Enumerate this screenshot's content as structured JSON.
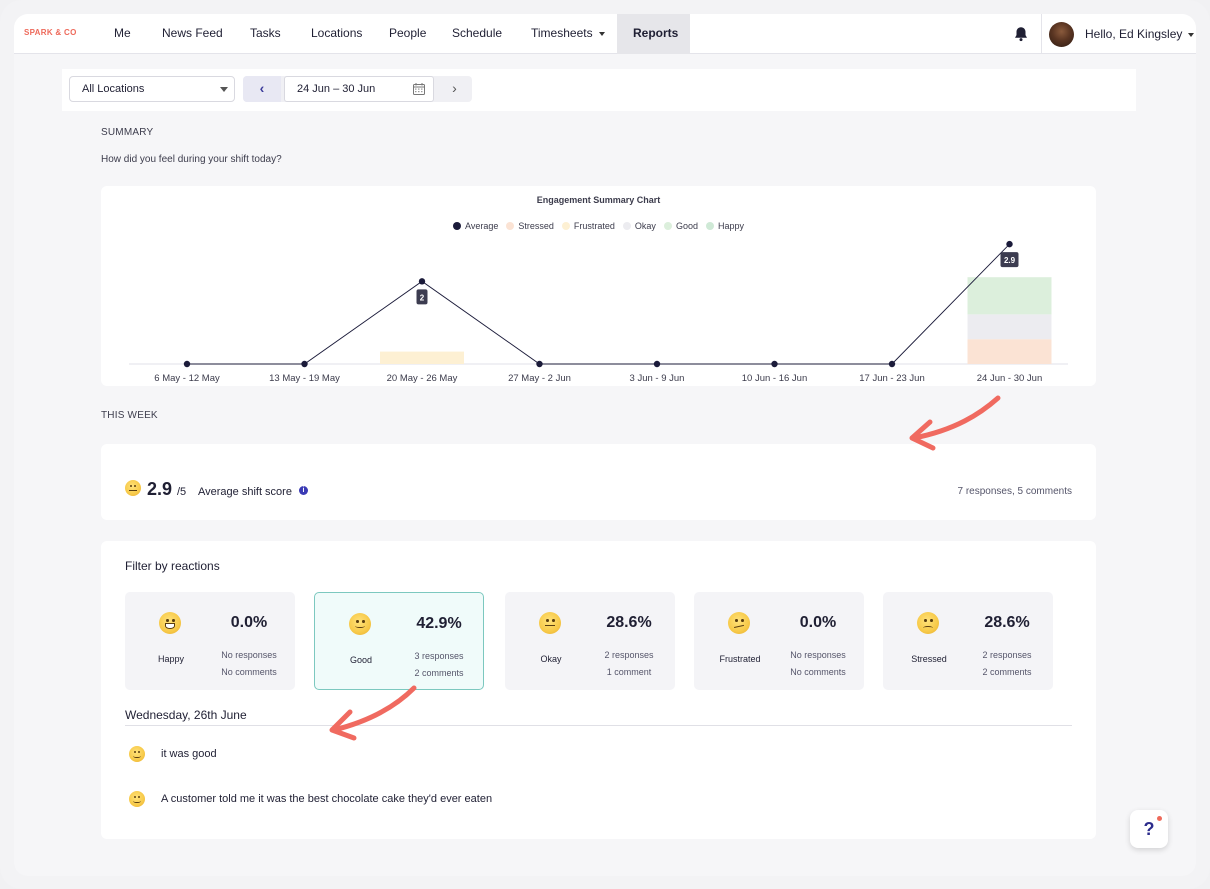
{
  "brand": "SPARK & CO",
  "nav": {
    "items": [
      {
        "label": "Me"
      },
      {
        "label": "News Feed"
      },
      {
        "label": "Tasks"
      },
      {
        "label": "Locations"
      },
      {
        "label": "People"
      },
      {
        "label": "Schedule"
      },
      {
        "label": "Timesheets"
      },
      {
        "label": "Reports"
      }
    ],
    "active": "Reports",
    "greeting": "Hello, Ed Kingsley"
  },
  "toolbar": {
    "location_select": "All Locations",
    "date_range": "24 Jun – 30 Jun"
  },
  "summary": {
    "heading": "SUMMARY",
    "question": "How did you feel during your shift today?"
  },
  "chart_data": {
    "type": "line",
    "title": "Engagement Summary Chart",
    "legend": [
      {
        "name": "Average",
        "color": "#1b1b3a"
      },
      {
        "name": "Stressed",
        "color": "#fbe3d4"
      },
      {
        "name": "Frustrated",
        "color": "#fdf0d3"
      },
      {
        "name": "Okay",
        "color": "#ececf0"
      },
      {
        "name": "Good",
        "color": "#dcefdc"
      },
      {
        "name": "Happy",
        "color": "#cfe9d6"
      }
    ],
    "categories": [
      "6 May - 12 May",
      "13 May - 19 May",
      "20 May - 26 May",
      "27 May - 2 Jun",
      "3 Jun - 9 Jun",
      "10 Jun - 16 Jun",
      "17 Jun - 23 Jun",
      "24 Jun - 30 Jun"
    ],
    "series": [
      {
        "name": "Average",
        "values": [
          0,
          0,
          2,
          0,
          0,
          0,
          0,
          2.9
        ]
      }
    ],
    "data_labels": [
      {
        "index": 2,
        "text": "2"
      },
      {
        "index": 7,
        "text": "2.9"
      }
    ],
    "stacks": [
      {
        "index": 2,
        "segments": [
          {
            "name": "Frustrated",
            "value": 0.3
          }
        ]
      },
      {
        "index": 7,
        "segments": [
          {
            "name": "Stressed",
            "value": 0.6
          },
          {
            "name": "Okay",
            "value": 0.6
          },
          {
            "name": "Good",
            "value": 0.9
          }
        ]
      }
    ],
    "ylim": [
      0,
      3
    ]
  },
  "this_week": {
    "heading": "THIS WEEK",
    "score": "2.9",
    "score_suffix": "/5",
    "score_label": "Average shift score",
    "responses_summary": "7 responses, 5 comments"
  },
  "filter": {
    "title": "Filter by reactions",
    "reactions": [
      {
        "name": "Happy",
        "percent": "0.0%",
        "responses": "No responses",
        "comments": "No comments",
        "icon": "grinning-face-icon"
      },
      {
        "name": "Good",
        "percent": "42.9%",
        "responses": "3 responses",
        "comments": "2 comments",
        "icon": "slightly-smiling-face-icon"
      },
      {
        "name": "Okay",
        "percent": "28.6%",
        "responses": "2 responses",
        "comments": "1 comment",
        "icon": "neutral-face-icon"
      },
      {
        "name": "Frustrated",
        "percent": "0.0%",
        "responses": "No responses",
        "comments": "No comments",
        "icon": "confused-face-icon"
      },
      {
        "name": "Stressed",
        "percent": "28.6%",
        "responses": "2 responses",
        "comments": "2 comments",
        "icon": "frowning-face-icon"
      }
    ],
    "selected": "Good"
  },
  "comments": {
    "day": "Wednesday, 26th June",
    "items": [
      {
        "text": "it was good"
      },
      {
        "text": "A customer told me it was the best chocolate cake they'd ever eaten"
      }
    ]
  },
  "help_label": "?"
}
